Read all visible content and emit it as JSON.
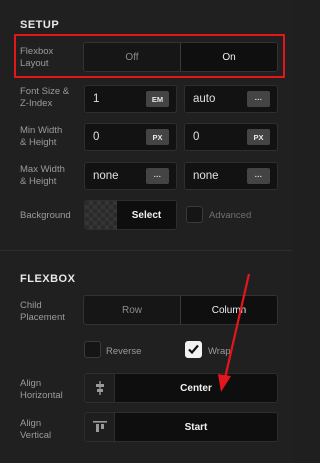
{
  "setup": {
    "title": "SETUP",
    "flexbox_layout": {
      "label_line1": "Flexbox",
      "label_line2": "Layout",
      "options": [
        "Off",
        "On"
      ],
      "selected": "On"
    },
    "font_size": {
      "label_line1": "Font Size &",
      "label_line2": "Z-Index",
      "value": "1",
      "unit": "EM",
      "zindex_value": "auto",
      "zindex_button": "···"
    },
    "min_size": {
      "label_line1": "Min Width",
      "label_line2": "& Height",
      "width_value": "0",
      "width_unit": "PX",
      "height_value": "0",
      "height_unit": "PX"
    },
    "max_size": {
      "label_line1": "Max Width",
      "label_line2": "& Height",
      "width_value": "none",
      "width_button": "···",
      "height_value": "none",
      "height_button": "···"
    },
    "background": {
      "label": "Background",
      "select_label": "Select",
      "advanced_label": "Advanced"
    }
  },
  "flexbox": {
    "title": "FLEXBOX",
    "child_placement": {
      "label_line1": "Child",
      "label_line2": "Placement",
      "options": [
        "Row",
        "Column"
      ],
      "selected": "Column"
    },
    "reverse": {
      "label": "Reverse",
      "checked": false
    },
    "wrap": {
      "label": "Wrap",
      "checked": true
    },
    "align_horizontal": {
      "label_line1": "Align",
      "label_line2": "Horizontal",
      "value": "Center",
      "icon": "align-center-horizontal-icon"
    },
    "align_vertical": {
      "label_line1": "Align",
      "label_line2": "Vertical",
      "value": "Start",
      "icon": "align-top-icon"
    }
  },
  "colors": {
    "background": "#202020",
    "field": "#121212",
    "highlight": "#e3161c",
    "text": "#e0e0e0"
  }
}
